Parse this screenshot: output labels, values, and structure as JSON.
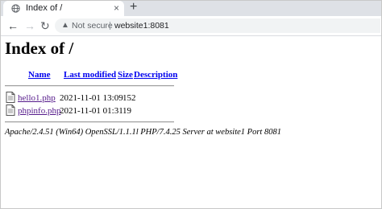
{
  "browser": {
    "tab": {
      "title": "Index of /",
      "icon": "globe-icon",
      "close_label": "×"
    },
    "new_tab_label": "+",
    "nav": {
      "back": "←",
      "forward": "→",
      "reload": "↻"
    },
    "omnibox": {
      "security_label": "Not secure",
      "url": "website1:8081",
      "warning_icon": "info-triangle-icon"
    }
  },
  "page": {
    "title": "Index of /",
    "columns": {
      "name": "Name",
      "last_modified": "Last modified",
      "size": "Size",
      "description": "Description"
    },
    "files": [
      {
        "name": "hello1.php",
        "modified": "2021-11-01 13:09",
        "size": "152",
        "icon": "file-icon"
      },
      {
        "name": "phpinfo.php",
        "modified": "2021-11-01 01:31",
        "size": "19",
        "icon": "file-icon"
      }
    ],
    "address": "Apache/2.4.51 (Win64) OpenSSL/1.1.1l PHP/7.4.25 Server at website1 Port 8081"
  },
  "colors": {
    "link": "#0000ee",
    "visited_link": "#551a8b",
    "tabstrip_bg": "#dee1e6",
    "omnibox_bg": "#f1f3f4"
  }
}
